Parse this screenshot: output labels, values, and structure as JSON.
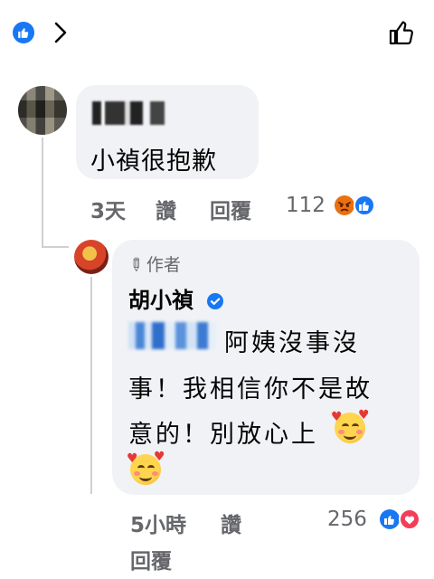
{
  "header": {
    "like_icon": "thumbs-up-badge-icon",
    "chevron_icon": "chevron-right-icon",
    "like_button_icon": "thumbs-up-outline-icon"
  },
  "comment1": {
    "text": "小禎很抱歉",
    "time": "3天",
    "like_label": "讚",
    "reply_label": "回覆",
    "reaction_count": "112",
    "reactions": [
      "angry-icon",
      "like-icon"
    ]
  },
  "reply1": {
    "author_tag": "作者",
    "name": "胡小禎",
    "line1": "阿姨沒事沒",
    "line2": "事！我相信你不是故",
    "line3": "意的！別放心上",
    "time": "5小時",
    "like_label": "讚",
    "reply_label": "回覆",
    "reaction_count": "256",
    "reactions": [
      "like-icon",
      "love-icon"
    ]
  },
  "colors": {
    "accent": "#1877f2",
    "bubble": "#f0f2f5",
    "meta": "#65676b",
    "love": "#f33e58",
    "angry": "#e9710f"
  }
}
